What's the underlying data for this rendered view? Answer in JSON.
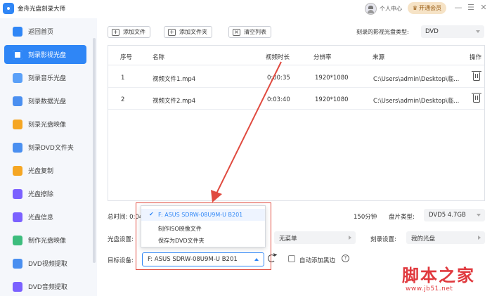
{
  "app": {
    "title": "金舟光盘刻录大师",
    "user_center": "个人中心",
    "vip_label": "开通会员"
  },
  "window_controls": [
    "—",
    "☰",
    "✕"
  ],
  "sidebar": {
    "items": [
      {
        "label": "返回首页",
        "icon": "home-icon",
        "color": "#2f86f6"
      },
      {
        "label": "刻录影视光盘",
        "icon": "film-disc-icon",
        "color": "#ffffff",
        "active": true
      },
      {
        "label": "刻录音乐光盘",
        "icon": "music-disc-icon",
        "color": "#5aa0f8"
      },
      {
        "label": "刻录数据光盘",
        "icon": "data-disc-icon",
        "color": "#4a8ff0"
      },
      {
        "label": "刻录光盘映像",
        "icon": "image-disc-icon",
        "color": "#f5a623"
      },
      {
        "label": "刻录DVD文件夹",
        "icon": "folder-dvd-icon",
        "color": "#4a8ff0"
      },
      {
        "label": "光盘复制",
        "icon": "copy-disc-icon",
        "color": "#f5a623"
      },
      {
        "label": "光盘擦除",
        "icon": "erase-disc-icon",
        "color": "#7b61ff"
      },
      {
        "label": "光盘信息",
        "icon": "info-disc-icon",
        "color": "#7b61ff"
      },
      {
        "label": "制作光盘映像",
        "icon": "make-image-icon",
        "color": "#3dbd7d"
      },
      {
        "label": "DVD视频提取",
        "icon": "dvd-video-extract-icon",
        "color": "#4a8ff0"
      },
      {
        "label": "DVD音频提取",
        "icon": "dvd-audio-extract-icon",
        "color": "#7b61ff"
      }
    ]
  },
  "toolbar": {
    "add_file": "添加文件",
    "add_folder": "添加文件夹",
    "clear_list": "清空列表",
    "disc_type_label": "刻录的影视光盘类型:",
    "disc_type_value": "DVD"
  },
  "table": {
    "headers": [
      "序号",
      "名称",
      "视频时长",
      "分辨率",
      "来源",
      "操作"
    ],
    "rows": [
      {
        "index": "1",
        "name": "视频文件1.mp4",
        "duration": "0:00:35",
        "resolution": "1920*1080",
        "source": "C:\\Users\\admin\\Desktop\\临..."
      },
      {
        "index": "2",
        "name": "视频文件2.mp4",
        "duration": "0:03:40",
        "resolution": "1920*1080",
        "source": "C:\\Users\\admin\\Desktop\\临..."
      }
    ]
  },
  "settings": {
    "total_time_label": "总时间: 0:04",
    "capacity_minutes": "150分钟",
    "disc_spec_label": "盘片类型:",
    "disc_spec_value": "DVD5 4.7GB",
    "disc_setting_label": "光盘设置:",
    "menu_value": "无菜单",
    "burn_setting_label": "刻录设置:",
    "burn_setting_value": "我的光盘",
    "target_device_label": "目标设备:",
    "target_device_value": "F: ASUS SDRW-08U9M-U B201",
    "auto_black_border_label": "自动添加黑边"
  },
  "device_dropdown": {
    "options": [
      {
        "label": "F: ASUS SDRW-08U9M-U B201",
        "selected": true
      },
      {
        "label": "制作ISO映像文件",
        "selected": false
      },
      {
        "label": "保存为DVD文件夹",
        "selected": false
      }
    ]
  },
  "watermark": {
    "site_name": "脚本之家",
    "url": "www.jb51.net"
  },
  "colors": {
    "accent": "#2f86f6",
    "annotation": "#e04a3f",
    "watermark": "#e0393e"
  }
}
